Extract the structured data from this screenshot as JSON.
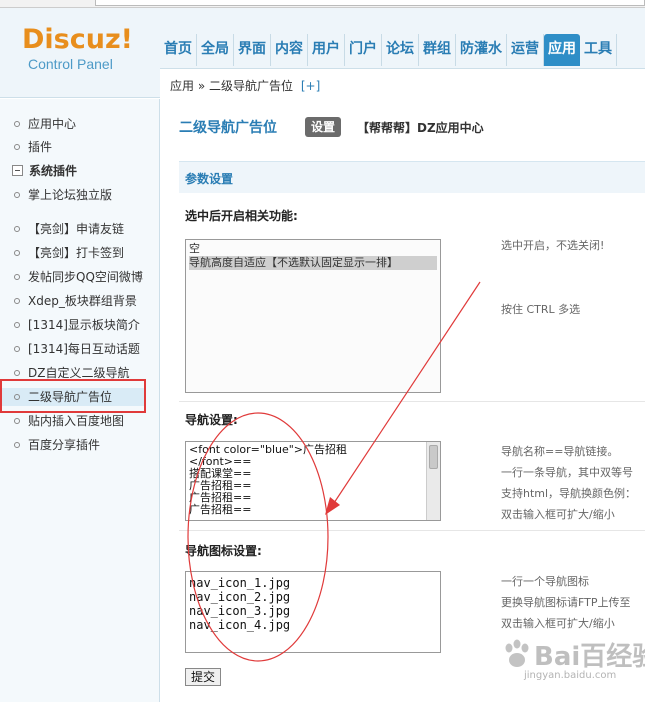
{
  "logo": {
    "name": "Discuz!",
    "subtitle": "Control Panel"
  },
  "nav": [
    {
      "label": "首页"
    },
    {
      "label": "全局"
    },
    {
      "label": "界面"
    },
    {
      "label": "内容"
    },
    {
      "label": "用户"
    },
    {
      "label": "门户"
    },
    {
      "label": "论坛"
    },
    {
      "label": "群组"
    },
    {
      "label": "防灌水"
    },
    {
      "label": "运营"
    },
    {
      "label": "应用",
      "active": true
    },
    {
      "label": "工具"
    }
  ],
  "breadcrumb": {
    "root": "应用",
    "separator": "»",
    "current": "二级导航广告位",
    "add": "[+]"
  },
  "sidebar": {
    "items": [
      {
        "label": "应用中心"
      },
      {
        "label": "插件"
      }
    ],
    "section": {
      "label": "系统插件"
    },
    "plugins": [
      {
        "label": "掌上论坛独立版"
      },
      {
        "label": "【亮剑】申请友链"
      },
      {
        "label": "【亮剑】打卡签到"
      },
      {
        "label": "发帖同步QQ空间微博"
      },
      {
        "label": "Xdep_板块群组背景"
      },
      {
        "label": "[1314]显示板块简介"
      },
      {
        "label": "[1314]每日互动话题"
      },
      {
        "label": "DZ自定义二级导航"
      },
      {
        "label": "二级导航广告位",
        "active": true
      },
      {
        "label": "贴内插入百度地图"
      },
      {
        "label": "百度分享插件"
      }
    ]
  },
  "main": {
    "title": "二级导航广告位",
    "settings_button": "设置",
    "app_link": "【帮帮帮】DZ应用中心",
    "section_title": "参数设置",
    "feature_field": {
      "label": "选中后开启相关功能:",
      "options": [
        {
          "label": "空",
          "selected": false
        },
        {
          "label": "导航高度自适应【不选默认固定显示一排】",
          "selected": true
        }
      ],
      "hints": [
        "选中开启，不选关闭!",
        "按住 CTRL 多选"
      ]
    },
    "nav_field": {
      "label": "导航设置:",
      "lines": [
        "<font color=\"blue\">广告招租",
        "</font>==",
        "搭配课堂==",
        "广告招租==",
        "广告招租==",
        "广告招租=="
      ],
      "hints": [
        "导航名称==导航链接。",
        "一行一条导航，其中双等号",
        "支持html，导航换颜色例：",
        "双击输入框可扩大/缩小"
      ]
    },
    "icon_field": {
      "label": "导航图标设置:",
      "lines": [
        "nav_icon_1.jpg",
        "nav_icon_2.jpg",
        "nav_icon_3.jpg",
        "nav_icon_4.jpg"
      ],
      "hints": [
        "一行一个导航图标",
        "更换导航图标请FTP上传至",
        "双击输入框可扩大/缩小"
      ]
    },
    "submit_label": "提交"
  },
  "watermark": {
    "text": "Bai百经验",
    "sub": "jingyan.baidu.com"
  },
  "colors": {
    "accent": "#2a7db4",
    "brand": "#e88e1d",
    "annotation": "#e03a3a"
  }
}
